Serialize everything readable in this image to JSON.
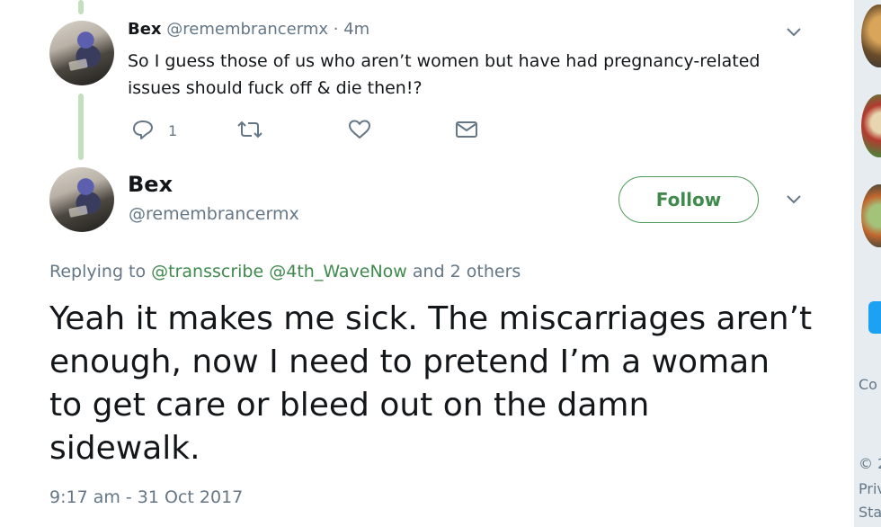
{
  "colors": {
    "thread_line": "#c3dfbe",
    "follow_accent": "#3f8a4c",
    "link": "#3f8a4c",
    "muted": "#657786",
    "text": "#14171a"
  },
  "parent_tweet": {
    "display_name": "Bex",
    "handle": "@remembrancermx",
    "separator": " · ",
    "time": "4m",
    "text_line1": "So I guess those of us who aren’t women but have had pregnancy-related",
    "text_line2": "issues should fuck off & die then!?",
    "reply_count": "1",
    "icons": [
      "reply-icon",
      "retweet-icon",
      "like-icon",
      "direct-message-icon",
      "chevron-down-icon"
    ]
  },
  "main_tweet": {
    "display_name": "Bex",
    "handle": "@remembrancermx",
    "follow_label": "Follow",
    "replying_prefix": "Replying to ",
    "replying_user1": "@transscribe",
    "replying_user2": "@4th_WaveNow",
    "replying_suffix": " and 2 others",
    "text_line1": "Yeah it makes me sick. The miscarriages aren’t",
    "text_line2": "enough, now I need to pretend I’m a woman",
    "text_line3": "to get care or bleed out on the damn",
    "text_line4": "sidewalk.",
    "timestamp": "9:17 am - 31 Oct 2017"
  },
  "sidebar": {
    "text_con": "Co",
    "text_copy": "© 2",
    "text_priv": "Priv",
    "text_sta": "Sta"
  }
}
